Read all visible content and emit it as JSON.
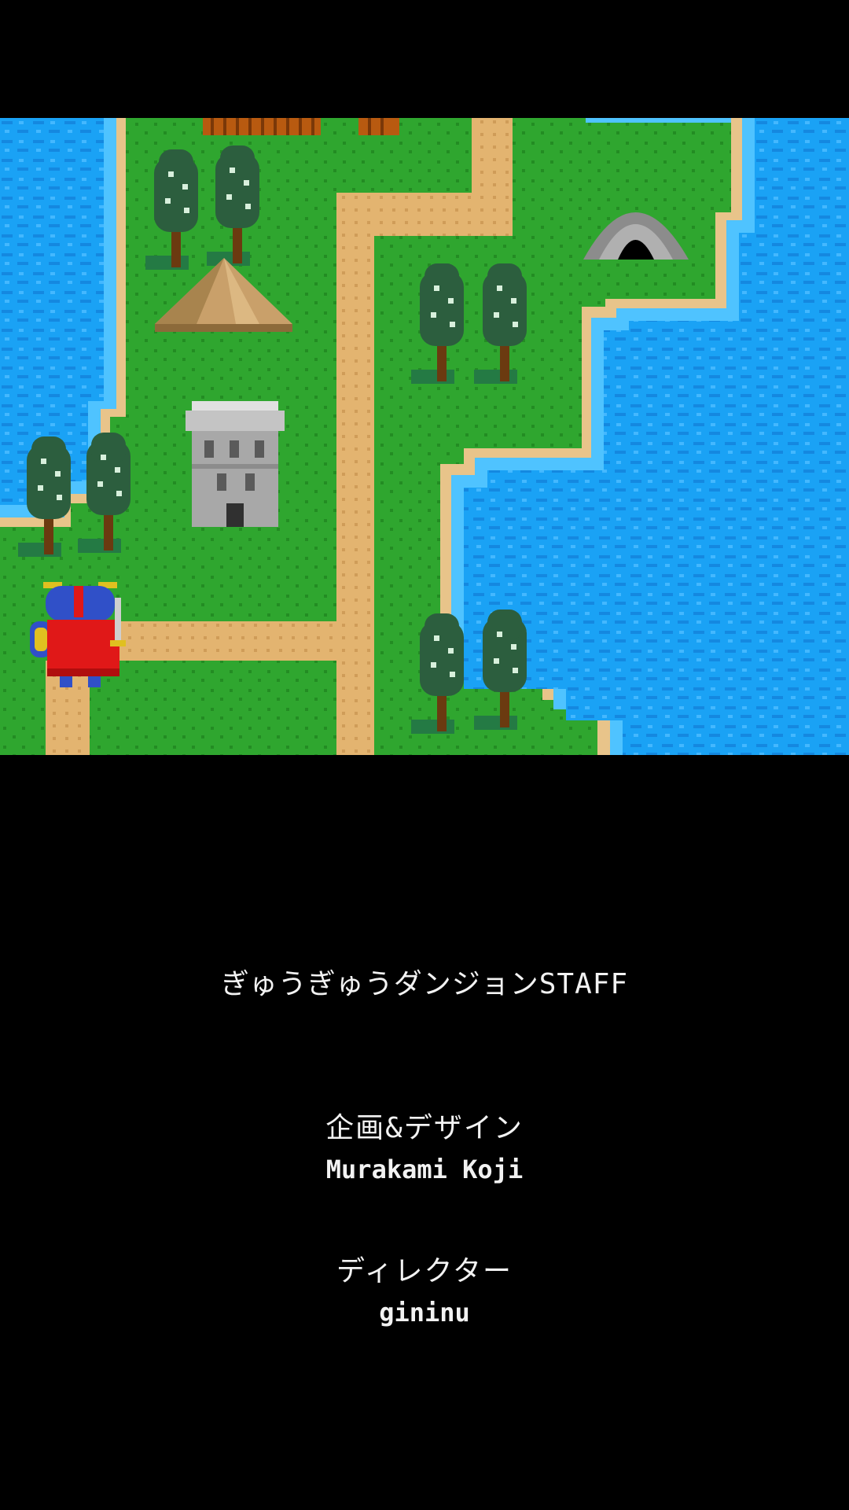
{
  "game": {
    "map": {
      "colors": {
        "grass": "#2fa62f",
        "grass_dot": "#228a22",
        "water": "#1aa2f5",
        "water_light": "#4fc3ff",
        "water_dark": "#1080d8",
        "shore": "#e8c48a",
        "path": "#e3b470",
        "tree_leaf": "#2c5e3e",
        "tree_trunk": "#6b3a10",
        "cave": "#8c8c8c",
        "tower": "#a8a8a8",
        "mountain": "#c9a06a",
        "hero_cape": "#e01818",
        "hero_helmet": "#3050c8"
      },
      "icons": [
        "tree-icon",
        "mountain-icon",
        "tower-icon",
        "cave-icon",
        "hero-icon",
        "bridge-icon"
      ]
    },
    "credits": {
      "title": "ぎゅうぎゅうダンジョンSTAFF",
      "entries": [
        {
          "role": "企画&デザイン",
          "name": "Murakami Koji"
        },
        {
          "role": "ディレクター",
          "name": "gininu"
        }
      ]
    }
  }
}
